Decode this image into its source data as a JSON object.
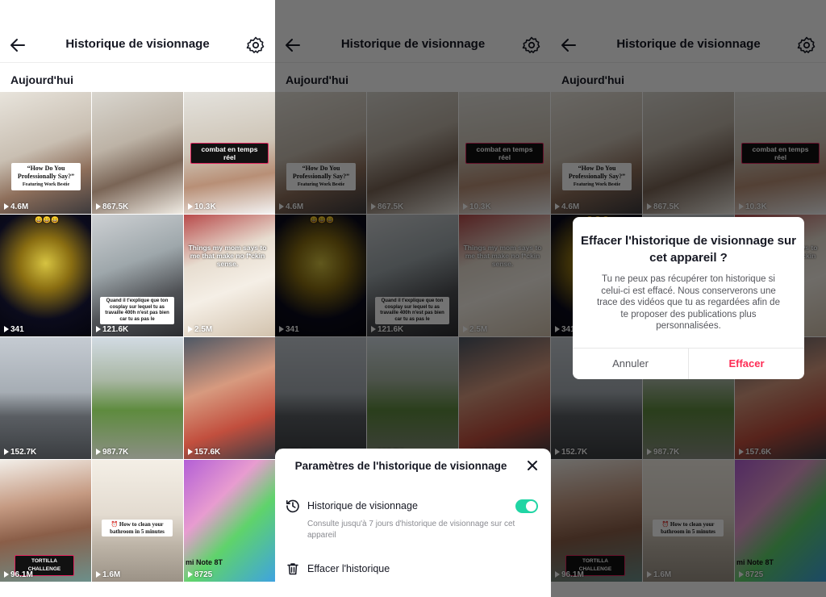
{
  "screen": {
    "title": "Historique de visionnage",
    "section": "Aujourd'hui"
  },
  "tiles": [
    {
      "views": "4.6M",
      "caption": "“How Do You Professionally Say?”",
      "caption_sub": "Featuring Work Bestie"
    },
    {
      "views": "867.5K"
    },
    {
      "views": "10.3K",
      "caption": "combat en temps réel"
    },
    {
      "views": "341",
      "caption": "😄😄😄"
    },
    {
      "views": "121.6K",
      "caption": "Quand il t'explique que ton cosplay sur lequel tu as travaille 400h n'est pas bien car tu as pas le"
    },
    {
      "views": "2.5M",
      "caption": "Things my mom says to me that make no f*ckin sense."
    },
    {
      "views": "152.7K"
    },
    {
      "views": "987.7K"
    },
    {
      "views": "157.6K"
    },
    {
      "views": "96.1M",
      "caption": "TORTILLA CHALLENGE"
    },
    {
      "views": "1.6M",
      "caption": "⏰ How to clean your bathroom in 5 minutes"
    },
    {
      "views": "8725",
      "caption": "mi Note 8T"
    }
  ],
  "sheet": {
    "title": "Paramètres de l'historique de visionnage",
    "history_label": "Historique de visionnage",
    "history_sub": "Consulte jusqu'à 7 jours d'historique de visionnage sur cet appareil",
    "history_enabled": true,
    "clear_label": "Effacer l'historique"
  },
  "dialog": {
    "title": "Effacer l'historique de visionnage sur cet appareil ?",
    "body": "Tu ne peux pas récupérer ton historique si celui-ci est effacé. Nous conserverons une trace des vidéos que tu as regardées afin de te proposer des publications plus personnalisées.",
    "cancel": "Annuler",
    "confirm": "Effacer"
  },
  "colors": {
    "accent_red": "#fe2c55",
    "toggle_green": "#20d5a4",
    "text_dark": "#161823",
    "text_gray": "#8a8b91"
  }
}
